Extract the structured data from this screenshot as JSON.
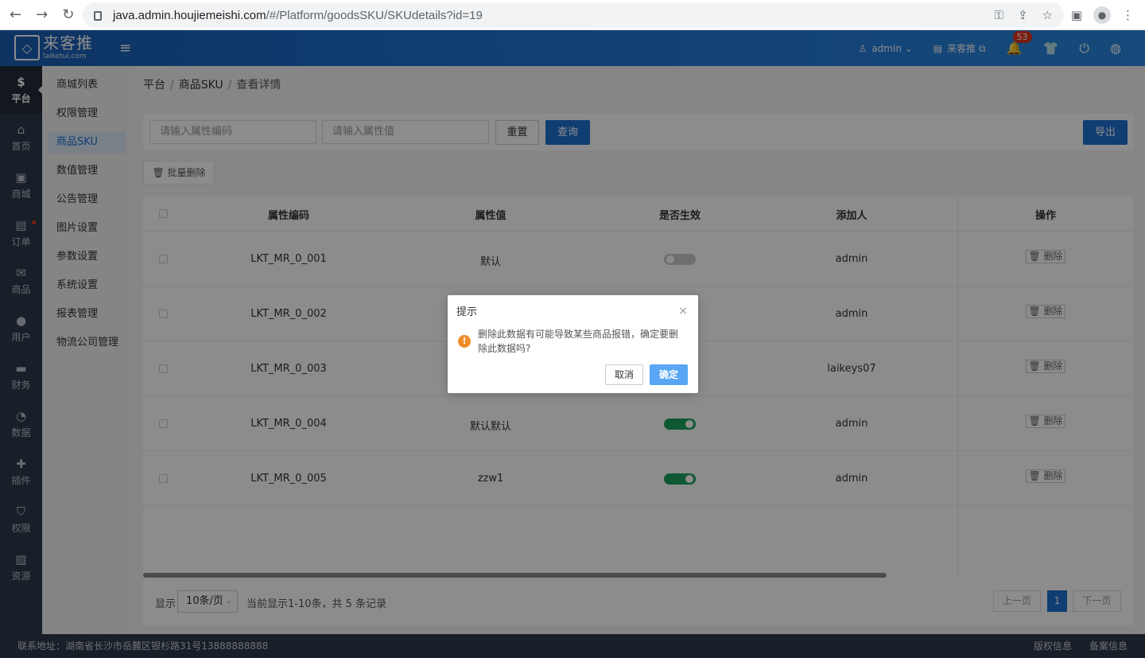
{
  "browser": {
    "url_host": "java.admin.houjiemeishi.com",
    "url_path": "/#/Platform/goodsSKU/SKUdetails?id=19",
    "back_glyph": "←",
    "forward_glyph": "→",
    "reload_glyph": "↻",
    "key_glyph": "⚿",
    "share_glyph": "⇪",
    "star_glyph": "☆",
    "sidepanel_glyph": "▣",
    "profile_glyph": "●",
    "menu_glyph": "⋮"
  },
  "header": {
    "logo_mark": "◇",
    "logo_cn": "来客推",
    "logo_en": "laiketui.com",
    "menu_glyph": "≡",
    "user": "admin ⌄",
    "user_glyph": "♙",
    "store": "来客推 ⧉",
    "store_glyph": "▤",
    "bell_glyph": "🔔",
    "notification_count": "53",
    "shirt_glyph": "👕",
    "power_glyph": "⏻",
    "globe_glyph": "◍"
  },
  "rail": [
    {
      "icon": "$",
      "label": "平台",
      "active": true
    },
    {
      "icon": "⌂",
      "label": "首页"
    },
    {
      "icon": "▣",
      "label": "商城"
    },
    {
      "icon": "▤",
      "label": "订单",
      "dot": true
    },
    {
      "icon": "✉",
      "label": "商品"
    },
    {
      "icon": "●",
      "label": "用户"
    },
    {
      "icon": "▬",
      "label": "财务"
    },
    {
      "icon": "◔",
      "label": "数据"
    },
    {
      "icon": "✚",
      "label": "插件"
    },
    {
      "icon": "⛉",
      "label": "权限"
    },
    {
      "icon": "▨",
      "label": "资源"
    }
  ],
  "submenu": [
    "商城列表",
    "权限管理",
    "商品SKU",
    "数值管理",
    "公告管理",
    "图片设置",
    "参数设置",
    "系统设置",
    "报表管理",
    "物流公司管理"
  ],
  "submenu_active": "商品SKU",
  "breadcrumb": {
    "a": "平台",
    "b": "商品SKU",
    "c": "查看详情",
    "sep": "/"
  },
  "filter": {
    "code_placeholder": "请输入属性编码",
    "value_placeholder": "请输入属性值",
    "reset": "重置",
    "query": "查询",
    "export": "导出"
  },
  "bulk_delete": "🗑 批量删除",
  "table": {
    "headers": {
      "code": "属性编码",
      "value": "属性值",
      "enabled": "是否生效",
      "added_by": "添加人",
      "ops": "操作"
    },
    "rows": [
      {
        "code": "LKT_MR_0_001",
        "value": "默认",
        "enabled": false,
        "added_by": "admin"
      },
      {
        "code": "LKT_MR_0_002",
        "value": "",
        "enabled": null,
        "added_by": "admin"
      },
      {
        "code": "LKT_MR_0_003",
        "value": "",
        "enabled": null,
        "added_by": "laikeys07"
      },
      {
        "code": "LKT_MR_0_004",
        "value": "默认默认",
        "enabled": true,
        "added_by": "admin"
      },
      {
        "code": "LKT_MR_0_005",
        "value": "zzw1",
        "enabled": true,
        "added_by": "admin"
      }
    ],
    "delete_label": "🗑 删除"
  },
  "pager": {
    "show": "显示",
    "page_size": "10条/页",
    "caret": "⌄",
    "info": "当前显示1-10条，共 5 条记录",
    "prev": "上一页",
    "current": "1",
    "next": "下一页"
  },
  "footer": {
    "address": "联系地址：湖南省长沙市岳麓区银杉路31号13888888888",
    "copyright": "版权信息",
    "icp": "备案信息"
  },
  "dialog": {
    "title": "提示",
    "close": "×",
    "warn_glyph": "!",
    "message": "删除此数据有可能导致某些商品报错，确定要删除此数据吗?",
    "cancel": "取消",
    "confirm": "确定"
  },
  "colors": {
    "header_blue": "#1e6fd0",
    "rail_bg": "#2f3a4a",
    "switch_on": "#1aa15f",
    "confirm_button": "#58a6f4",
    "warning_orange": "#f08c2b"
  }
}
